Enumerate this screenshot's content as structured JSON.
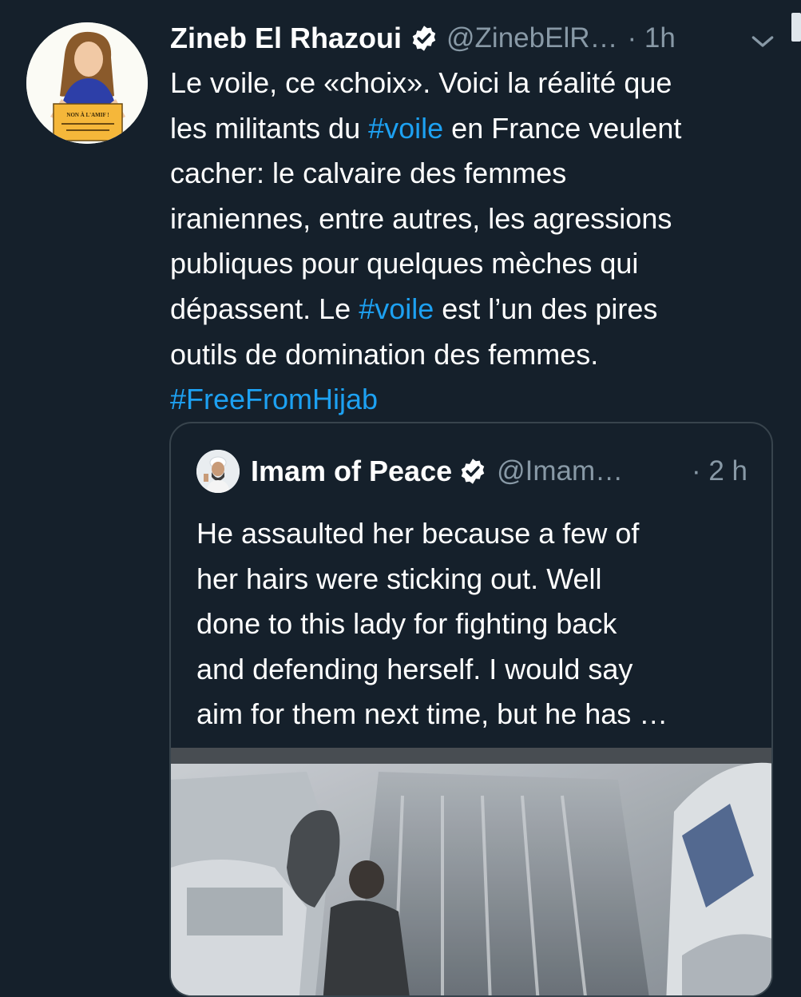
{
  "tweet": {
    "display_name": "Zineb El Rhazoui",
    "handle": "@ZinebElR…",
    "time": "· 1h",
    "avatar_sign_text": "NON À L'AMIF !",
    "body_lines": [
      [
        {
          "text": "Le voile, ce «choix». Voici la réalité que"
        }
      ],
      [
        {
          "text": "les militants du "
        },
        {
          "text": "#voile",
          "tag": true
        },
        {
          "text": " en France veulent"
        }
      ],
      [
        {
          "text": "cacher: le calvaire des femmes"
        }
      ],
      [
        {
          "text": "iraniennes, entre autres, les agressions"
        }
      ],
      [
        {
          "text": "publiques pour quelques mèches qui"
        }
      ],
      [
        {
          "text": "dépassent. Le "
        },
        {
          "text": "#voile",
          "tag": true
        },
        {
          "text": " est l’un des pires"
        }
      ],
      [
        {
          "text": "outils de domination des femmes."
        }
      ],
      [
        {
          "text": "#FreeFromHijab",
          "tag": true
        }
      ]
    ]
  },
  "quoted": {
    "display_name": "Imam of Peace",
    "handle": "@Imam…",
    "time": "· 2 h",
    "body_lines": [
      "He assaulted her because a few of",
      "her hairs were sticking out. Well",
      "done to this lady for fighting back",
      "and defending herself. I would say",
      "aim for them next time, but he has …"
    ]
  },
  "icons": {
    "verified": "verified-badge-icon",
    "caret": "chevron-down-icon"
  },
  "colors": {
    "background": "#15202b",
    "link": "#1da1f2",
    "secondary_text": "#8899a6",
    "border": "#38444d"
  }
}
